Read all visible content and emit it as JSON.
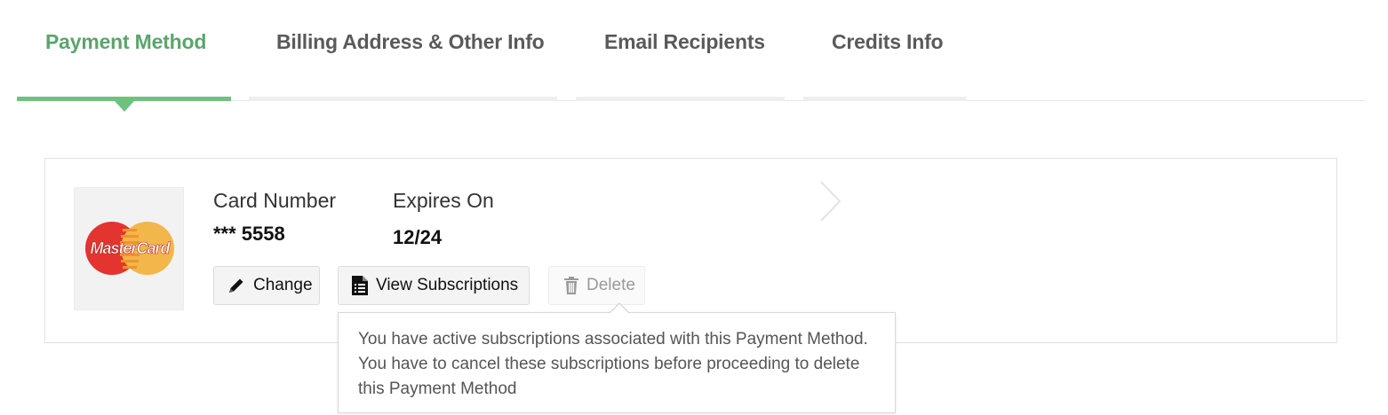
{
  "tabs": [
    {
      "label": "Payment Method",
      "active": true
    },
    {
      "label": "Billing Address & Other Info",
      "active": false
    },
    {
      "label": "Email Recipients",
      "active": false
    },
    {
      "label": "Credits Info",
      "active": false
    }
  ],
  "colors": {
    "accent_green": "#5aa66c",
    "tab_underline_active": "#6fc27d",
    "mastercard_red": "#e3342f",
    "mastercard_orange": "#f2b64b"
  },
  "card": {
    "brand_logo": "MasterCard",
    "number_label": "Card Number",
    "number_value": "*** 5558",
    "expires_label": "Expires On",
    "expires_value": "12/24"
  },
  "actions": {
    "change_label": "Change",
    "change_icon": "pencil-icon",
    "view_subscriptions_label": "View Subscriptions",
    "view_subscriptions_icon": "document-list-icon",
    "delete_label": "Delete",
    "delete_icon": "trash-icon",
    "delete_disabled": true
  },
  "tooltip": {
    "text": "You have active subscriptions associated with this Payment Method. You have to cancel these subscriptions before proceeding to delete this Payment Method"
  }
}
